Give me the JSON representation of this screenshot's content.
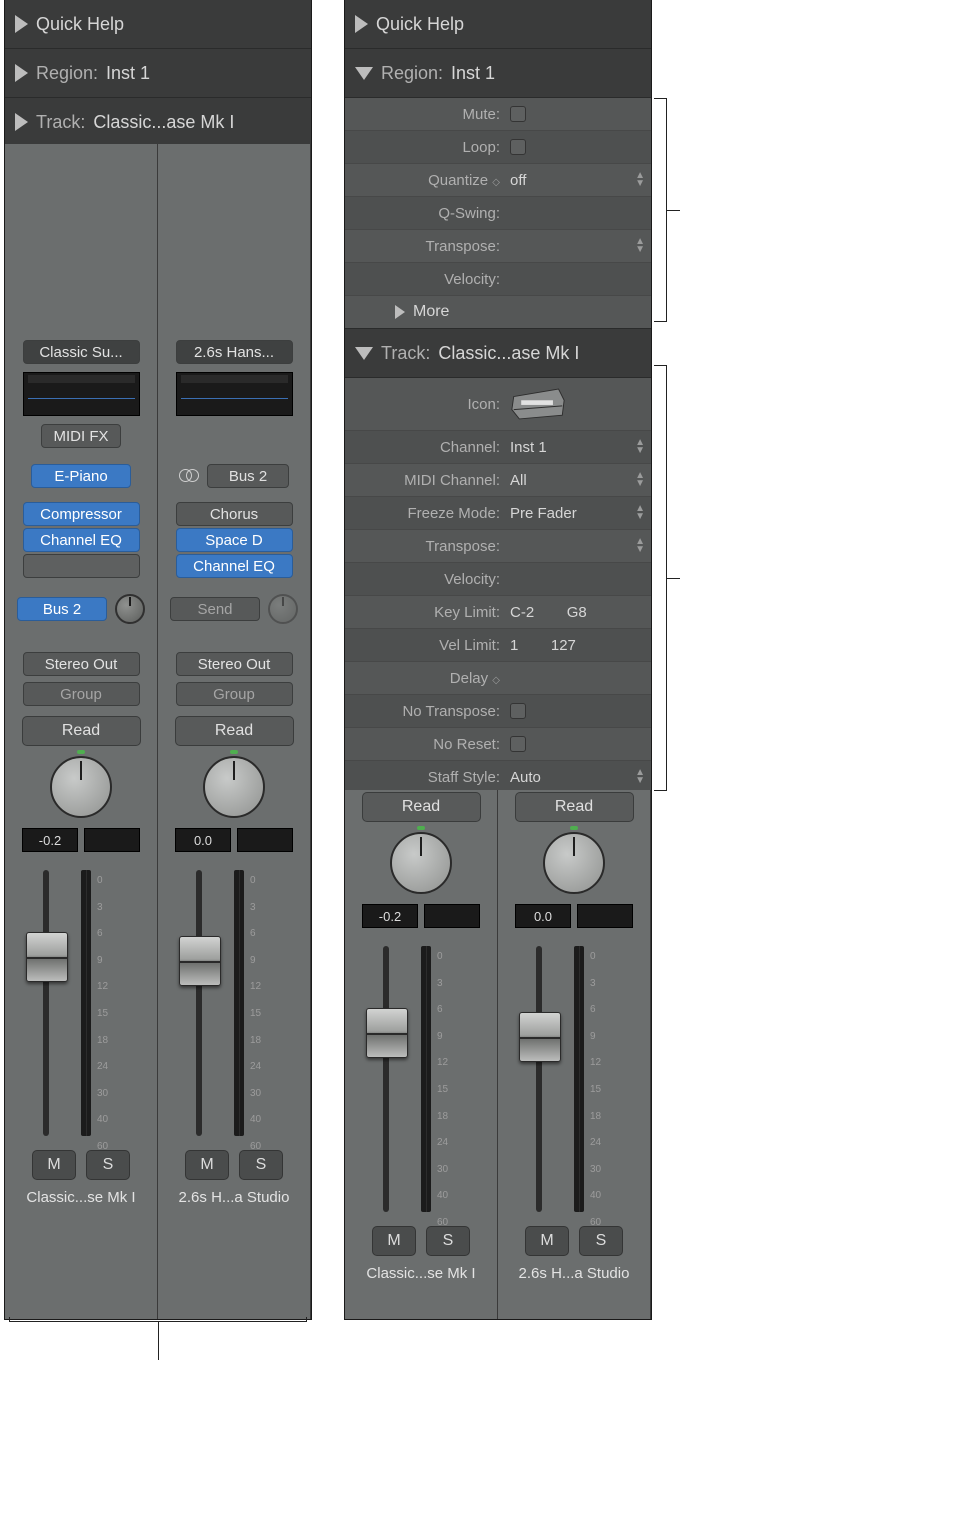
{
  "left": {
    "quick_help": "Quick Help",
    "region_label": "Region:",
    "region_value": "Inst 1",
    "track_label": "Track:",
    "track_value": "Classic...ase Mk I",
    "strips": [
      {
        "preset": "Classic Su...",
        "midifx": "MIDI FX",
        "instrument": "E-Piano",
        "inserts": [
          "Compressor",
          "Channel EQ"
        ],
        "send_label": "Bus 2",
        "output": "Stereo Out",
        "group": "Group",
        "automation": "Read",
        "db": "-0.2",
        "mute": "M",
        "solo": "S",
        "name": "Classic...se Mk I"
      },
      {
        "preset": "2.6s Hans...",
        "instrument": "Bus 2",
        "inserts": [
          "Chorus",
          "Space D",
          "Channel EQ"
        ],
        "send_label": "Send",
        "output": "Stereo Out",
        "group": "Group",
        "automation": "Read",
        "db": "0.0",
        "mute": "M",
        "solo": "S",
        "name": "2.6s H...a Studio"
      }
    ]
  },
  "right": {
    "quick_help": "Quick Help",
    "region_label": "Region:",
    "region_value": "Inst 1",
    "region_params": {
      "mute": "Mute:",
      "loop": "Loop:",
      "quantize_label": "Quantize",
      "quantize_value": "off",
      "qswing": "Q-Swing:",
      "transpose": "Transpose:",
      "velocity": "Velocity:",
      "more": "More"
    },
    "track_label": "Track:",
    "track_value": "Classic...ase Mk I",
    "track_params": {
      "icon": "Icon:",
      "channel_l": "Channel:",
      "channel_v": "Inst 1",
      "midich_l": "MIDI Channel:",
      "midich_v": "All",
      "freeze_l": "Freeze Mode:",
      "freeze_v": "Pre Fader",
      "transpose": "Transpose:",
      "velocity": "Velocity:",
      "keylimit_l": "Key Limit:",
      "keylimit_lo": "C-2",
      "keylimit_hi": "G8",
      "vellimit_l": "Vel Limit:",
      "vellimit_lo": "1",
      "vellimit_hi": "127",
      "delay": "Delay",
      "notrans": "No Transpose:",
      "noreset": "No Reset:",
      "staff_l": "Staff Style:",
      "staff_v": "Auto"
    },
    "strips": [
      {
        "automation": "Read",
        "db": "-0.2",
        "mute": "M",
        "solo": "S",
        "name": "Classic...se Mk I"
      },
      {
        "automation": "Read",
        "db": "0.0",
        "mute": "M",
        "solo": "S",
        "name": "2.6s H...a Studio"
      }
    ]
  },
  "scale_marks": [
    "0",
    "3",
    "6",
    "9",
    "12",
    "15",
    "18",
    "24",
    "30",
    "40",
    "60"
  ]
}
